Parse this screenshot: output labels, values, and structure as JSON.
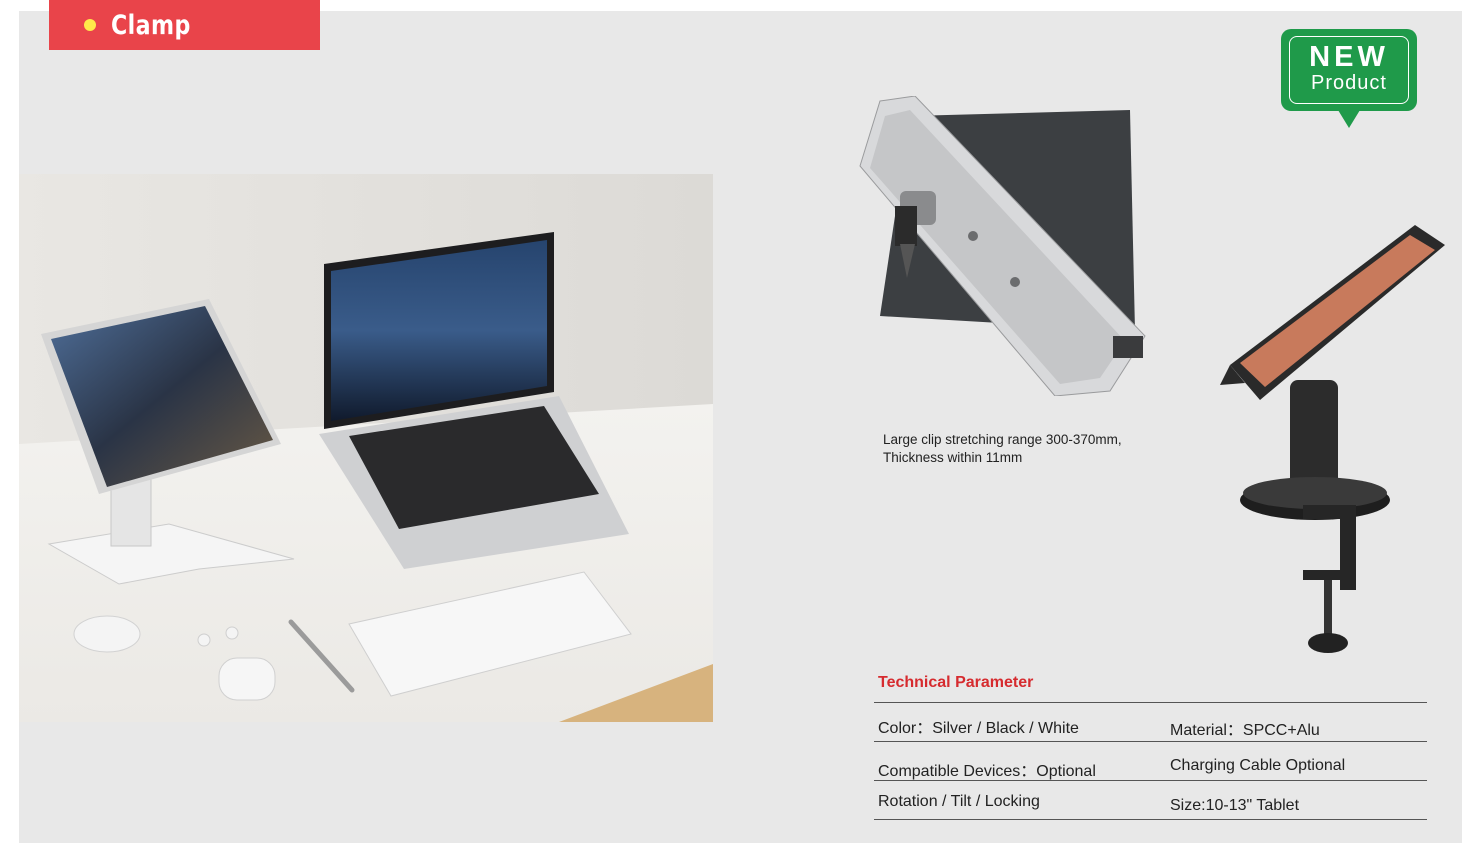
{
  "section": {
    "label": "Clamp"
  },
  "badge": {
    "line1": "NEW",
    "line2": "Product"
  },
  "caption": {
    "line1": "Large clip stretching range 300-370mm,",
    "line2": "Thickness within 11mm"
  },
  "technical": {
    "title": "Technical Parameter",
    "rows": [
      {
        "left": "Color：Silver / Black / White",
        "right": "Material：SPCC+Alu"
      },
      {
        "left": "Compatible Devices：Optional",
        "right": "Charging Cable Optional"
      },
      {
        "left": "Rotation / Tilt / Locking",
        "right": "Size:10-13\" Tablet"
      }
    ]
  },
  "colors": {
    "accent_red": "#e9444a",
    "badge_green": "#1f9a4a",
    "title_red": "#d62b2f",
    "background": "#e8e8e8"
  }
}
